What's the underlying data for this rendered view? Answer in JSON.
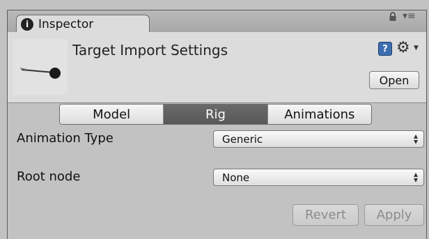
{
  "tab": {
    "title": "Inspector",
    "icon": "info-icon"
  },
  "window_controls": {
    "lock": "lock-icon",
    "menu": "menu-icon"
  },
  "header": {
    "title": "Target Import Settings",
    "help_icon": "?",
    "open_label": "Open"
  },
  "segments": [
    {
      "label": "Model",
      "active": false
    },
    {
      "label": "Rig",
      "active": true
    },
    {
      "label": "Animations",
      "active": false
    }
  ],
  "fields": {
    "animation_type": {
      "label": "Animation Type",
      "value": "Generic"
    },
    "root_node": {
      "label": "Root node",
      "value": "None"
    }
  },
  "footer": {
    "revert_label": "Revert",
    "apply_label": "Apply"
  },
  "colors": {
    "active_segment": "#5f5f5f",
    "panel_bg": "#c2c2c2",
    "header_bg": "#dcdcdc"
  }
}
